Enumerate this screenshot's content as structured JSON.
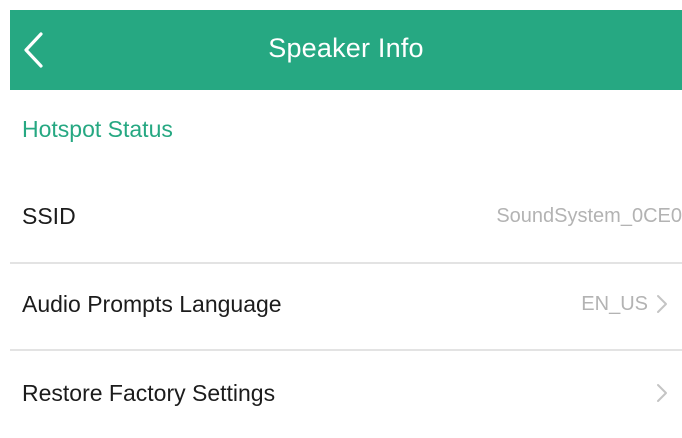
{
  "navbar": {
    "title": "Speaker Info",
    "back_icon": "chevron-left-icon",
    "background_color": "#26a882"
  },
  "section": {
    "header": "Hotspot Status",
    "header_color": "#26a882"
  },
  "rows": [
    {
      "label": "SSID",
      "value": "SoundSystem_0CE0",
      "has_chevron": false
    },
    {
      "label": "Audio Prompts Language",
      "value": "EN_US",
      "has_chevron": true,
      "chevron_icon": "chevron-right-icon"
    },
    {
      "label": "Restore Factory Settings",
      "value": "",
      "has_chevron": true,
      "chevron_icon": "chevron-right-icon"
    }
  ],
  "colors": {
    "label_text": "#1c1c1c",
    "value_text": "#b3b3b3",
    "divider": "#e3e3e3"
  }
}
